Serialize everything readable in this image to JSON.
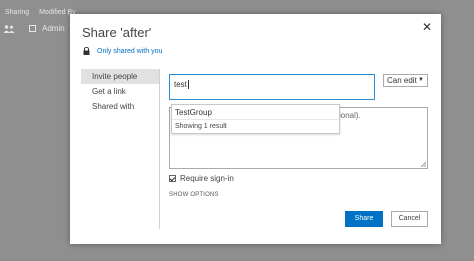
{
  "background": {
    "headers": [
      "Sharing",
      "Modified By"
    ],
    "row_user": "Admin"
  },
  "dialog": {
    "title": "Share 'after'",
    "close_symbol": "✕",
    "shared_status": "Only shared with you",
    "nav": [
      "Invite people",
      "Get a link",
      "Shared with"
    ],
    "people_input_value": "test",
    "permission": "Can edit",
    "message_visible_tail": "ional).",
    "suggestion": {
      "item": "TestGroup",
      "count": "Showing 1 result"
    },
    "require_signin_label": "Require sign-in",
    "require_signin_checked": true,
    "show_options_label": "SHOW OPTIONS",
    "share_label": "Share",
    "cancel_label": "Cancel"
  },
  "colors": {
    "accent": "#0072c6",
    "input_focus_border": "#2a8dd4",
    "overlay": "#8f8f8f"
  }
}
